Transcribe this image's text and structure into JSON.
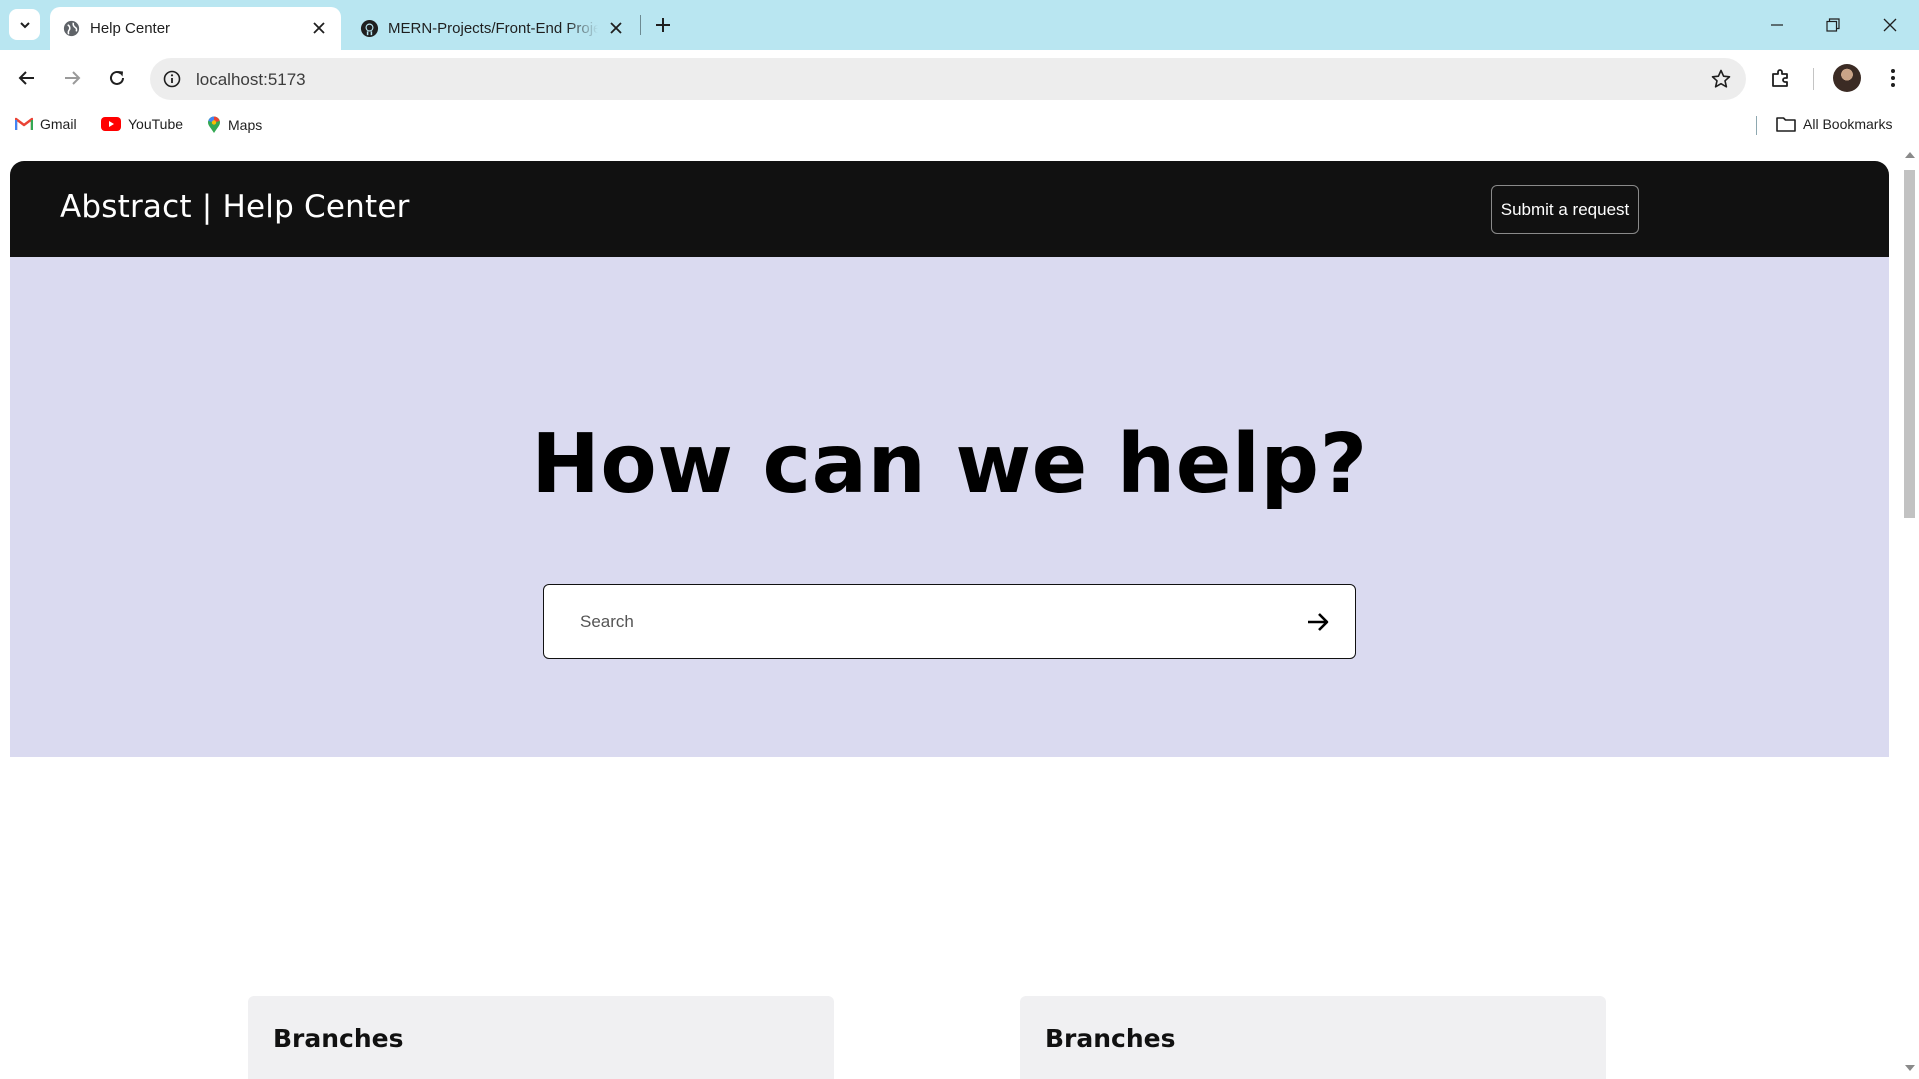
{
  "browser": {
    "tabs": [
      {
        "title": "Help Center",
        "active": true,
        "favicon": "globe-icon"
      },
      {
        "title": "MERN-Projects/Front-End Proje",
        "active": false,
        "favicon": "github-icon"
      }
    ],
    "address": "localhost:5173",
    "bookmarks": [
      {
        "label": "Gmail",
        "icon": "gmail-icon"
      },
      {
        "label": "YouTube",
        "icon": "youtube-icon"
      },
      {
        "label": "Maps",
        "icon": "maps-icon"
      }
    ],
    "all_bookmarks": "All Bookmarks"
  },
  "header": {
    "brand": "Abstract | Help Center",
    "submit_label": "Submit a request"
  },
  "hero": {
    "title": "How can we help?",
    "search_placeholder": "Search"
  },
  "cards": [
    {
      "title": "Branches"
    },
    {
      "title": "Branches"
    }
  ],
  "colors": {
    "tabstrip": "#b9e6f1",
    "header_bg": "#111111",
    "hero_bg": "#dadaf0",
    "card_bg": "#f0f0f2"
  }
}
